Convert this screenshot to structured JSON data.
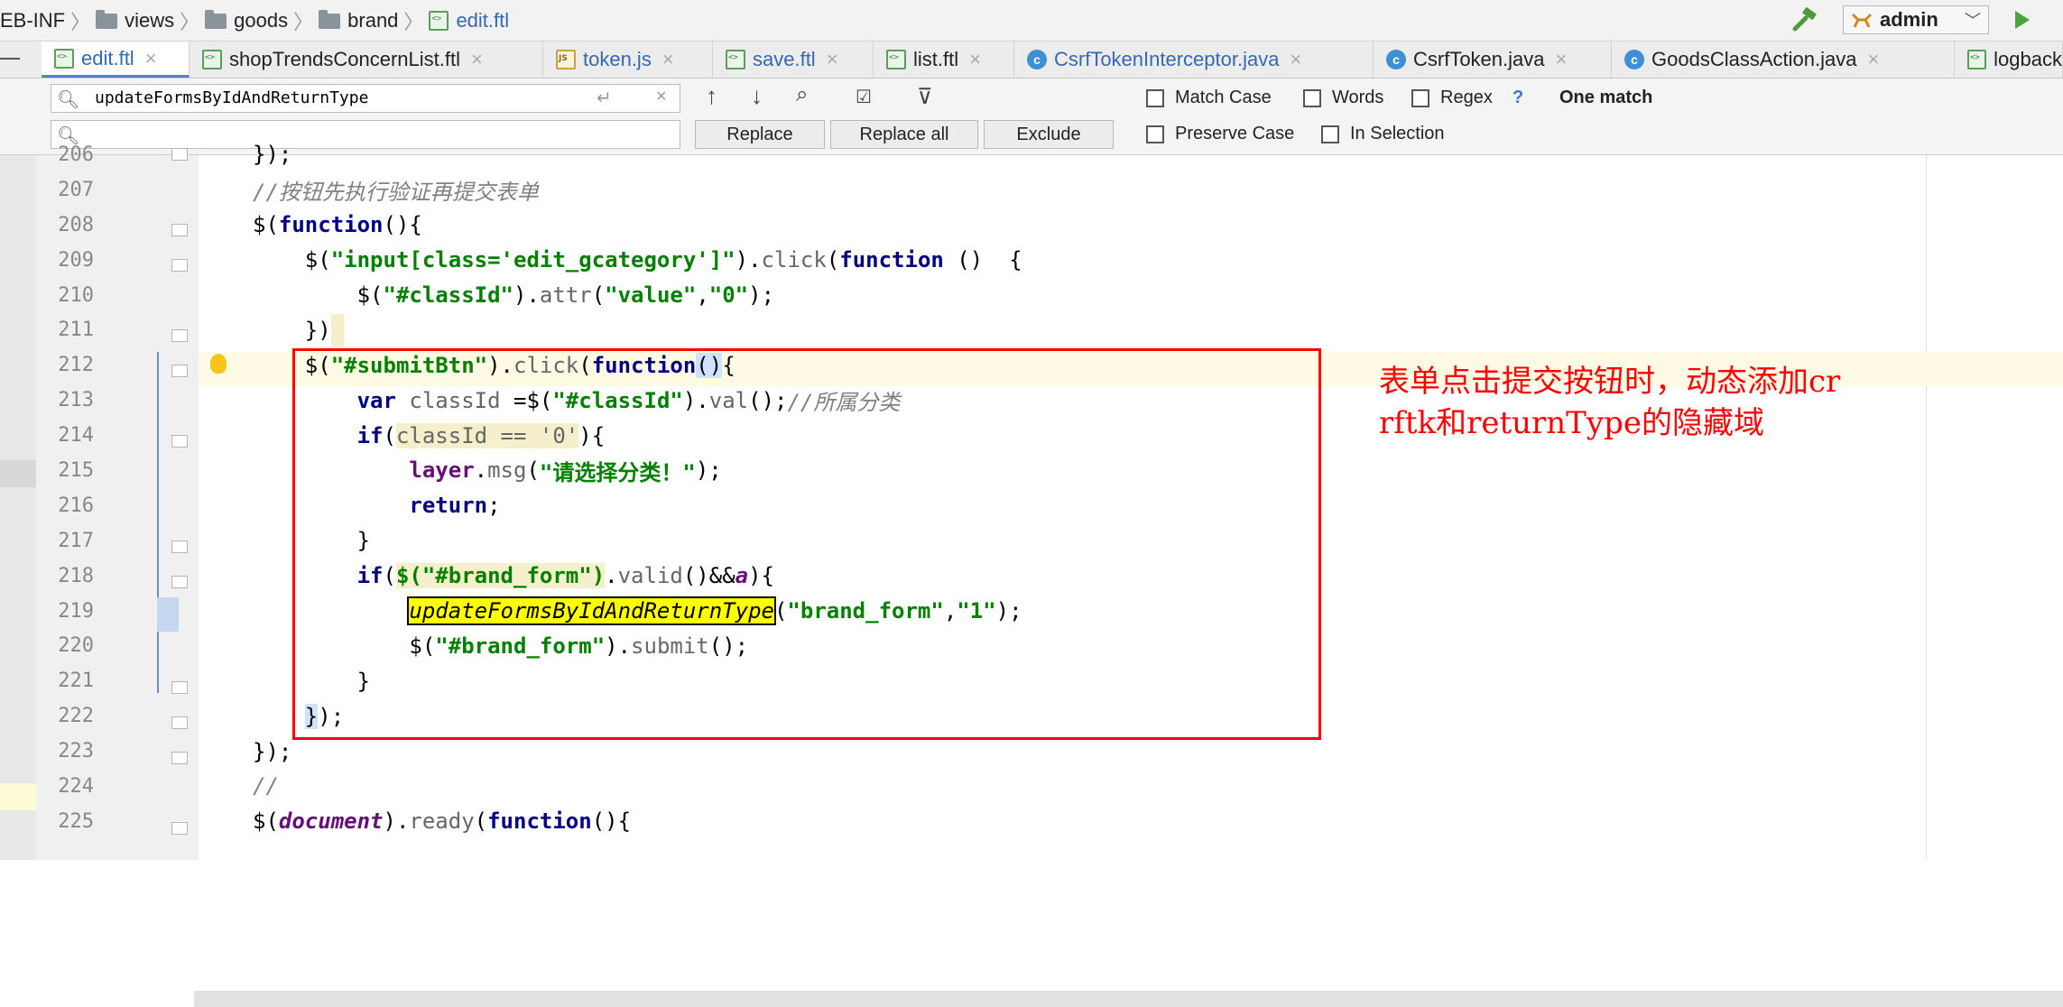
{
  "breadcrumb": {
    "items": [
      "EB-INF",
      "views",
      "goods",
      "brand",
      "edit.ftl"
    ]
  },
  "toolbar": {
    "hammer_icon": "hammer-icon",
    "run_config": "admin",
    "run_icon": "run-icon"
  },
  "tabs": [
    {
      "label": "edit.ftl",
      "icon": "ftl"
    },
    {
      "label": "shopTrendsConcernList.ftl",
      "icon": "ftl"
    },
    {
      "label": "token.js",
      "icon": "js"
    },
    {
      "label": "save.ftl",
      "icon": "ftl"
    },
    {
      "label": "list.ftl",
      "icon": "ftl"
    },
    {
      "label": "CsrfTokenInterceptor.java",
      "icon": "class"
    },
    {
      "label": "CsrfToken.java",
      "icon": "class"
    },
    {
      "label": "GoodsClassAction.java",
      "icon": "class"
    },
    {
      "label": "logback",
      "icon": "ftl"
    }
  ],
  "search": {
    "find_value": "updateFormsByIdAndReturnType",
    "replace_value": "",
    "replace_label": "Replace",
    "replace_all_label": "Replace all",
    "exclude_label": "Exclude",
    "match_case": "Match Case",
    "words": "Words",
    "regex": "Regex",
    "regex_help": "?",
    "preserve_case": "Preserve Case",
    "in_selection": "In Selection",
    "result": "One match"
  },
  "code": {
    "line_numbers": [
      "206",
      "207",
      "208",
      "209",
      "210",
      "211",
      "212",
      "213",
      "214",
      "215",
      "216",
      "217",
      "218",
      "219",
      "220",
      "221",
      "222",
      "223",
      "224",
      "225"
    ],
    "l206": "});",
    "l207": "//按钮先执行验证再提交表单",
    "l208": "function",
    "l209a": "\"input[class='edit_gcategory']\"",
    "l209b": "click",
    "l209c": "function",
    "l210a": "\"#classId\"",
    "l210b": "attr",
    "l210c": "\"value\"",
    "l210d": "\"0\"",
    "l212a": "\"#submitBtn\"",
    "l212b": "click",
    "l212c": "function",
    "l213a": "var",
    "l213b": "classId",
    "l213c": "\"#classId\"",
    "l213d": "val",
    "l213e": "//所属分类",
    "l214a": "if",
    "l214b": "classId == '0'",
    "l215a": "layer",
    "l215b": "msg",
    "l215c": "\"请选择分类！\"",
    "l216": "return",
    "l218a": "if",
    "l218b": "$(\"#brand_form\")",
    "l218c": "valid",
    "l218d": "a",
    "l219a": "updateFormsByIdAndReturnType",
    "l219b": "\"brand_form\"",
    "l219c": "\"1\"",
    "l220a": "\"#brand_form\"",
    "l220b": "submit",
    "l224": "//",
    "l225a": "document",
    "l225b": "ready",
    "l225c": "function"
  },
  "annotation": {
    "line1": "表单点击提交按钮时，动态添加cr",
    "line2": "rftk和returnType的隐藏域"
  }
}
